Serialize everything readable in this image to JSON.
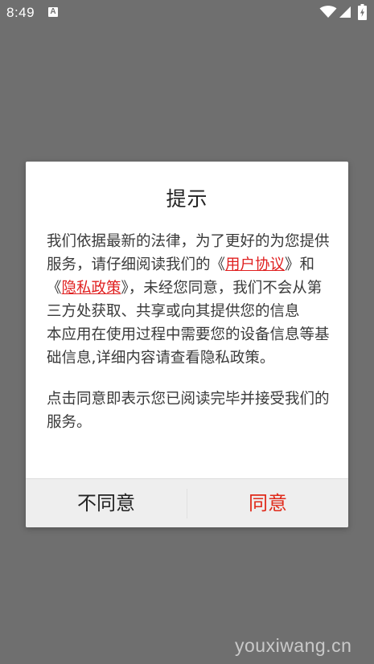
{
  "status_bar": {
    "time": "8:49",
    "notification_icon_letter": "A"
  },
  "dialog": {
    "title": "提示",
    "body": {
      "p1_before_link1": "我们依据最新的法律，为了更好的为您提供服务，请仔细阅读我们的《",
      "link_user_agreement": "用户协议",
      "p1_between_links": "》和《",
      "link_privacy_policy": "隐私政策",
      "p1_after_link2": "》，未经您同意，我们不会从第三方处获取、共享或向其提供您的信息",
      "p2": "本应用在使用过程中需要您的设备信息等基础信息,详细内容请查看隐私政策。",
      "p3": "点击同意即表示您已阅读完毕并接受我们的服务。"
    },
    "buttons": {
      "disagree": "不同意",
      "agree": "同意"
    }
  },
  "watermark": "youxiwang.cn",
  "colors": {
    "overlay_background": "#6f6f6f",
    "link": "#e02020",
    "agree_button": "#e02a1a"
  }
}
